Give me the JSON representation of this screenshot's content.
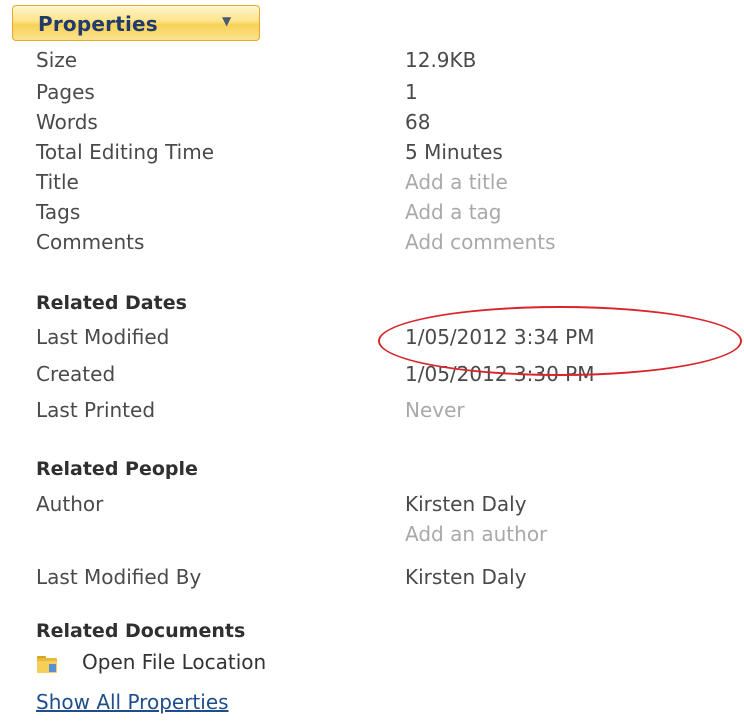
{
  "properties_button": {
    "label": "Properties",
    "icon": "chevron-down-icon"
  },
  "properties": [
    {
      "key": "Size",
      "value": "12.9KB",
      "placeholder": false
    },
    {
      "key": "Pages",
      "value": "1",
      "placeholder": false
    },
    {
      "key": "Words",
      "value": "68",
      "placeholder": false
    },
    {
      "key": "Total Editing Time",
      "value": "5 Minutes",
      "placeholder": false
    },
    {
      "key": "Title",
      "value": "Add a title",
      "placeholder": true
    },
    {
      "key": "Tags",
      "value": "Add a tag",
      "placeholder": true
    },
    {
      "key": "Comments",
      "value": "Add comments",
      "placeholder": true
    }
  ],
  "related_dates": {
    "title": "Related Dates",
    "rows": [
      {
        "key": "Last Modified",
        "value": "1/05/2012 3:34 PM"
      },
      {
        "key": "Created",
        "value": "1/05/2012 3:30 PM"
      },
      {
        "key": "Last Printed",
        "value": "Never"
      }
    ]
  },
  "related_people": {
    "title": "Related People",
    "author_label": "Author",
    "author_value": "Kirsten Daly",
    "add_author": "Add an author",
    "last_modified_by_label": "Last Modified By",
    "last_modified_by_value": "Kirsten Daly"
  },
  "related_documents": {
    "title": "Related Documents",
    "open_file_location": "Open File Location",
    "folder_icon": "folder-icon"
  },
  "show_all_properties": "Show All Properties",
  "colors": {
    "accent_button": "#fde48a",
    "highlight": "#d9252a",
    "link": "#1f4e8c",
    "placeholder": "#a9a9a9"
  }
}
